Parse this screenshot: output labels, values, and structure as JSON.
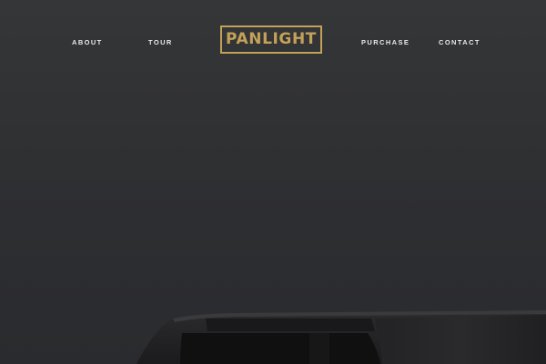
{
  "nav": {
    "about": "ABOUT",
    "tour": "TOUR",
    "purchase": "PURCHASE",
    "contact": "CONTACT"
  },
  "logo": {
    "text": "PANLIGHT",
    "color": "#c3a159"
  },
  "colors": {
    "background": "#2d2e31",
    "nav_text": "#e8e8e8",
    "accent": "#c3a159"
  },
  "hero": {
    "image": "device-product-image"
  }
}
